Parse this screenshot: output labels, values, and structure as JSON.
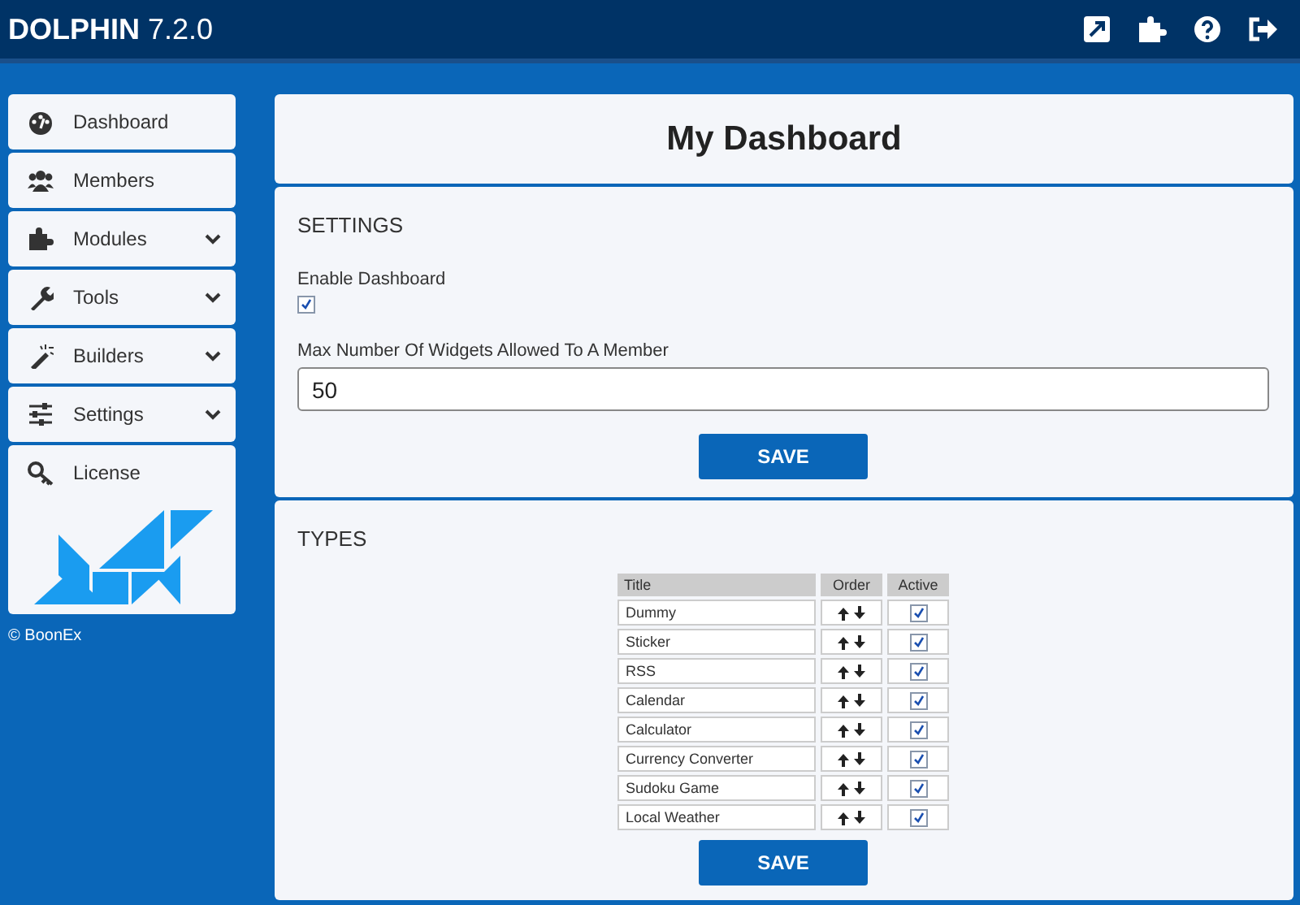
{
  "header": {
    "brand": "DOLPHIN",
    "version": "7.2.0"
  },
  "sidebar": {
    "items": [
      {
        "label": "Dashboard",
        "kind": "dashboard",
        "expandable": false
      },
      {
        "label": "Members",
        "kind": "members",
        "expandable": false
      },
      {
        "label": "Modules",
        "kind": "modules",
        "expandable": true
      },
      {
        "label": "Tools",
        "kind": "tools",
        "expandable": true
      },
      {
        "label": "Builders",
        "kind": "builders",
        "expandable": true
      },
      {
        "label": "Settings",
        "kind": "settings",
        "expandable": true
      },
      {
        "label": "License",
        "kind": "license",
        "expandable": false
      }
    ],
    "copyright": "© BoonEx"
  },
  "page_title": "My Dashboard",
  "settings": {
    "heading": "SETTINGS",
    "enable_label": "Enable Dashboard",
    "enabled": true,
    "max_label": "Max Number Of Widgets Allowed To A Member",
    "max_value": "50",
    "save": "SAVE"
  },
  "types": {
    "heading": "TYPES",
    "columns": [
      "Title",
      "Order",
      "Active"
    ],
    "rows": [
      {
        "title": "Dummy",
        "active": true
      },
      {
        "title": "Sticker",
        "active": true
      },
      {
        "title": "RSS",
        "active": true
      },
      {
        "title": "Calendar",
        "active": true
      },
      {
        "title": "Calculator",
        "active": true
      },
      {
        "title": "Currency Converter",
        "active": true
      },
      {
        "title": "Sudoku Game",
        "active": true
      },
      {
        "title": "Local Weather",
        "active": true
      }
    ],
    "save": "SAVE"
  }
}
